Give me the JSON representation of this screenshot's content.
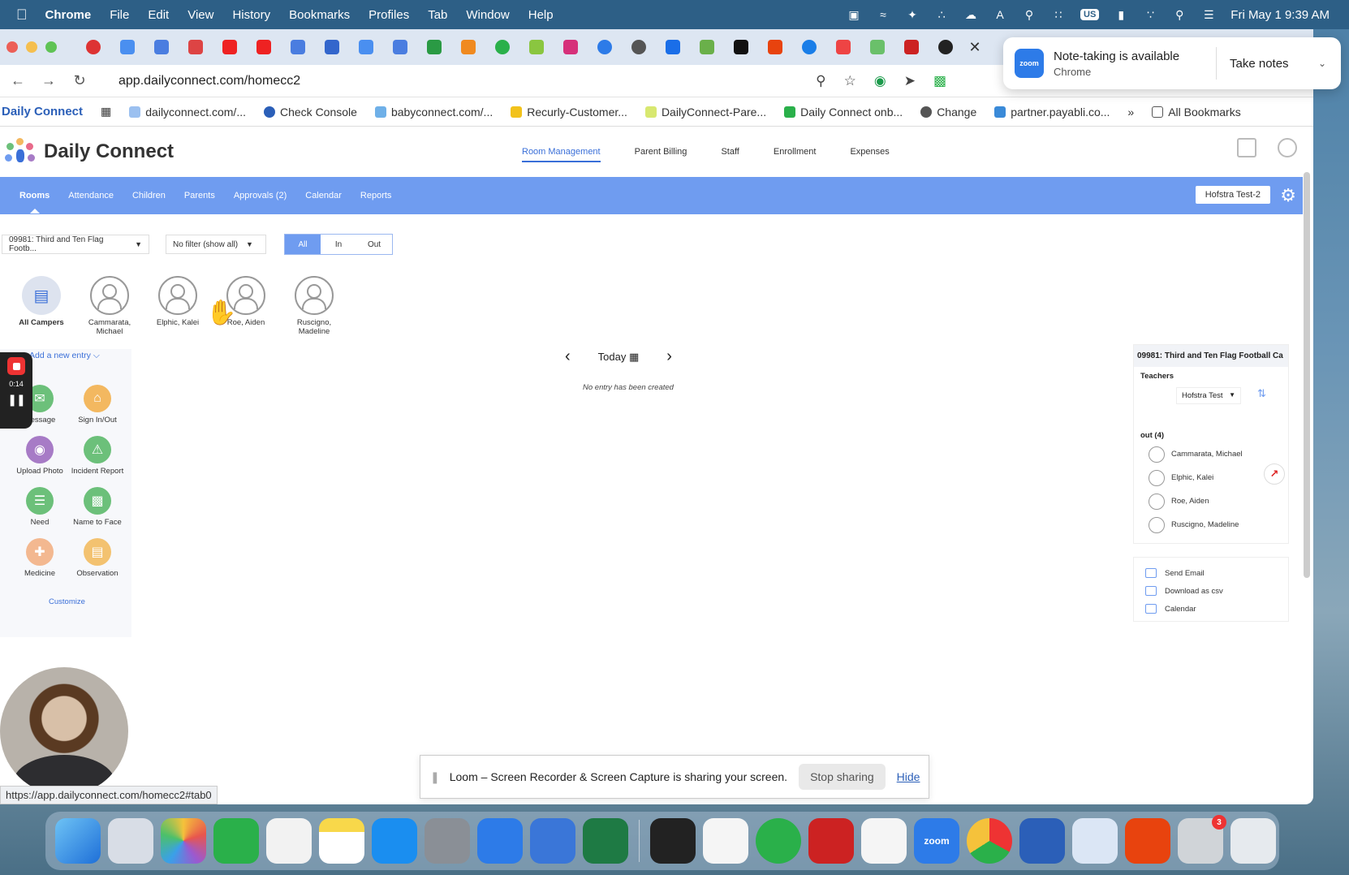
{
  "menubar": {
    "app": "Chrome",
    "items": [
      "File",
      "Edit",
      "View",
      "History",
      "Bookmarks",
      "Profiles",
      "Tab",
      "Window",
      "Help"
    ],
    "input_badge": "US",
    "clock": "Fri May 1  9:39 AM"
  },
  "browser": {
    "url": "app.dailyconnect.com/homecc2",
    "bookmarks": [
      "Daily Connect",
      "dailyconnect.com/...",
      "Check Console",
      "babyconnect.com/...",
      "Recurly-Customer...",
      "DailyConnect-Pare...",
      "Daily Connect onb...",
      "Change",
      "partner.payabli.co..."
    ],
    "all_bookmarks": "All Bookmarks",
    "status_url": "https://app.dailyconnect.com/homecc2#tab0"
  },
  "app": {
    "logo": "Daily Connect",
    "top_nav": [
      "Room Management",
      "Parent Billing",
      "Staff",
      "Enrollment",
      "Expenses"
    ],
    "sub_nav": [
      "Rooms",
      "Attendance",
      "Children",
      "Parents",
      "Approvals (2)",
      "Calendar",
      "Reports"
    ],
    "site": "Hofstra Test-2"
  },
  "filters": {
    "room": "09981: Third and Ten Flag Footb...",
    "filter": "No filter (show all)",
    "segments": [
      "All",
      "In",
      "Out"
    ]
  },
  "campers": [
    {
      "name": "All Campers"
    },
    {
      "name": "Cammarata, Michael"
    },
    {
      "name": "Elphic, Kalei"
    },
    {
      "name": "Roe, Aiden"
    },
    {
      "name": "Ruscigno, Madeline"
    }
  ],
  "left_panel": {
    "add_entry": "Add a new entry",
    "actions": [
      {
        "label": "Message",
        "color": "#6cc07a"
      },
      {
        "label": "Sign In/Out",
        "color": "#f3b860"
      },
      {
        "label": "Upload Photo",
        "color": "#a77bc6"
      },
      {
        "label": "Incident Report",
        "color": "#6cc07a"
      },
      {
        "label": "Need",
        "color": "#6cc07a"
      },
      {
        "label": "Name to Face",
        "color": "#6cc07a"
      },
      {
        "label": "Medicine",
        "color": "#f3b890"
      },
      {
        "label": "Observation",
        "color": "#f3c270"
      }
    ],
    "customize": "Customize"
  },
  "recorder": {
    "time": "0:14"
  },
  "center": {
    "date": "Today",
    "empty": "No entry has been created"
  },
  "room_panel": {
    "title": "09981: Third and Ten Flag Football Ca",
    "teachers_label": "Teachers",
    "teacher": "Hofstra Test",
    "out_label": "out (4)",
    "out": [
      "Cammarata, Michael",
      "Elphic, Kalei",
      "Roe, Aiden",
      "Ruscigno, Madeline"
    ]
  },
  "export": [
    "Send Email",
    "Download as csv",
    "Calendar"
  ],
  "zoom_popup": {
    "title": "Note-taking is available",
    "source": "Chrome",
    "action": "Take notes",
    "logo": "zoom"
  },
  "loom_bar": {
    "message": "Loom – Screen Recorder & Screen Capture is sharing your screen.",
    "stop": "Stop sharing",
    "hide": "Hide"
  },
  "dock": {
    "zoom_label": "zoom",
    "printer_badge": "3"
  }
}
